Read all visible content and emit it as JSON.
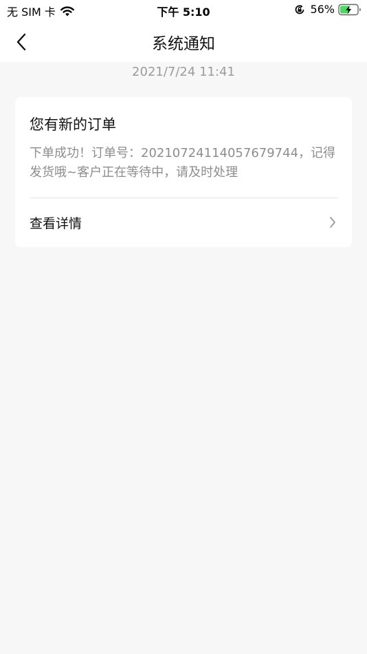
{
  "status_bar": {
    "carrier": "无 SIM 卡",
    "time": "下午 5:10",
    "battery_percent": "56%",
    "battery_level": 0.56,
    "battery_color": "#4cd964"
  },
  "nav": {
    "title": "系统通知"
  },
  "messages": [
    {
      "timestamp": "2021/7/24 11:41",
      "title": "您有新的订单",
      "body": "下单成功！订单号：20210724114057679744，记得发货哦~客户正在等待中，请及时处理",
      "action_label": "查看详情"
    }
  ]
}
